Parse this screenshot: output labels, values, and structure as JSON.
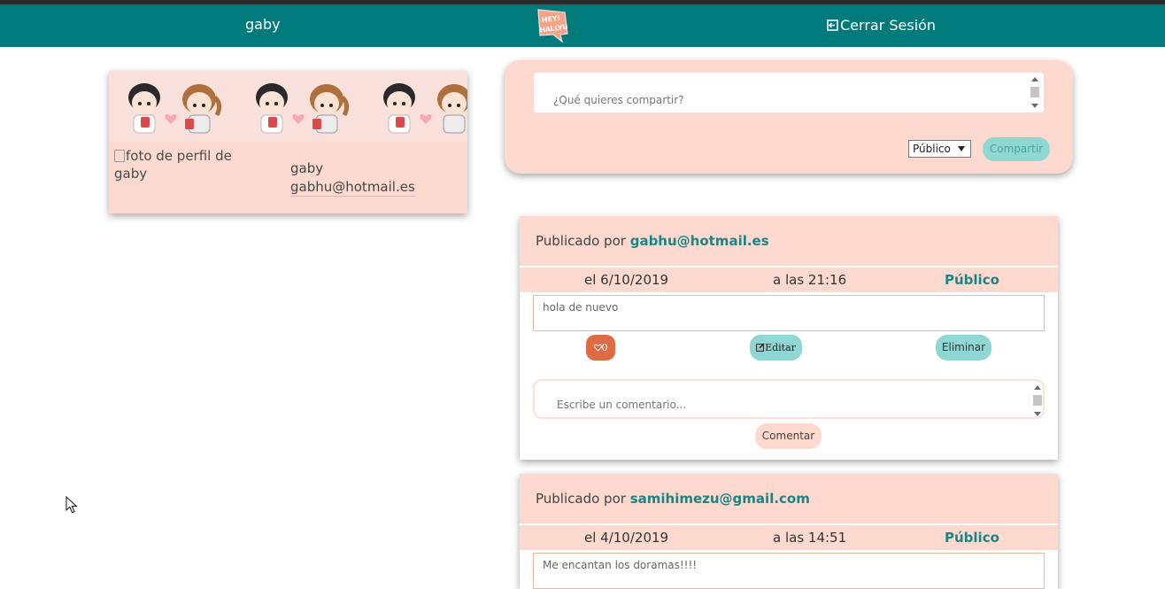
{
  "navbar": {
    "username": "gaby",
    "logo_text": "HEY! HALLYU",
    "logout_label": "Cerrar Sesión",
    "logout_icon": "logout-icon",
    "color": "#017a7b"
  },
  "profile": {
    "image_alt": "foto de perfil de gaby",
    "name": "gaby",
    "email": "gabhu@hotmail.es",
    "banner": "chibi-couple-pattern"
  },
  "composer": {
    "placeholder": "¿Qué quieres compartir?",
    "privacy_selected": "Público",
    "share_label": "Compartir"
  },
  "posts": [
    {
      "by_label": "Publicado por",
      "author": "gabhu@hotmail.es",
      "date": "el 6/10/2019",
      "time": "a las 21:16",
      "privacy": "Público",
      "content": "hola de nuevo",
      "likes": "0",
      "edit_label": "Editar",
      "delete_label": "Eliminar",
      "comment_placeholder": "Escribe un comentario...",
      "comment_label": "Comentar"
    },
    {
      "by_label": "Publicado por",
      "author": "samihimezu@gmail.com",
      "date": "el 4/10/2019",
      "time": "a las 14:51",
      "privacy": "Público",
      "content": "Me encantan los doramas!!!!"
    }
  ],
  "colors": {
    "teal": "#017a7b",
    "peach": "#fed9cf",
    "mint_button": "#8fd7d2",
    "like_button": "#dc6b46",
    "author_text": "#1b8583"
  }
}
